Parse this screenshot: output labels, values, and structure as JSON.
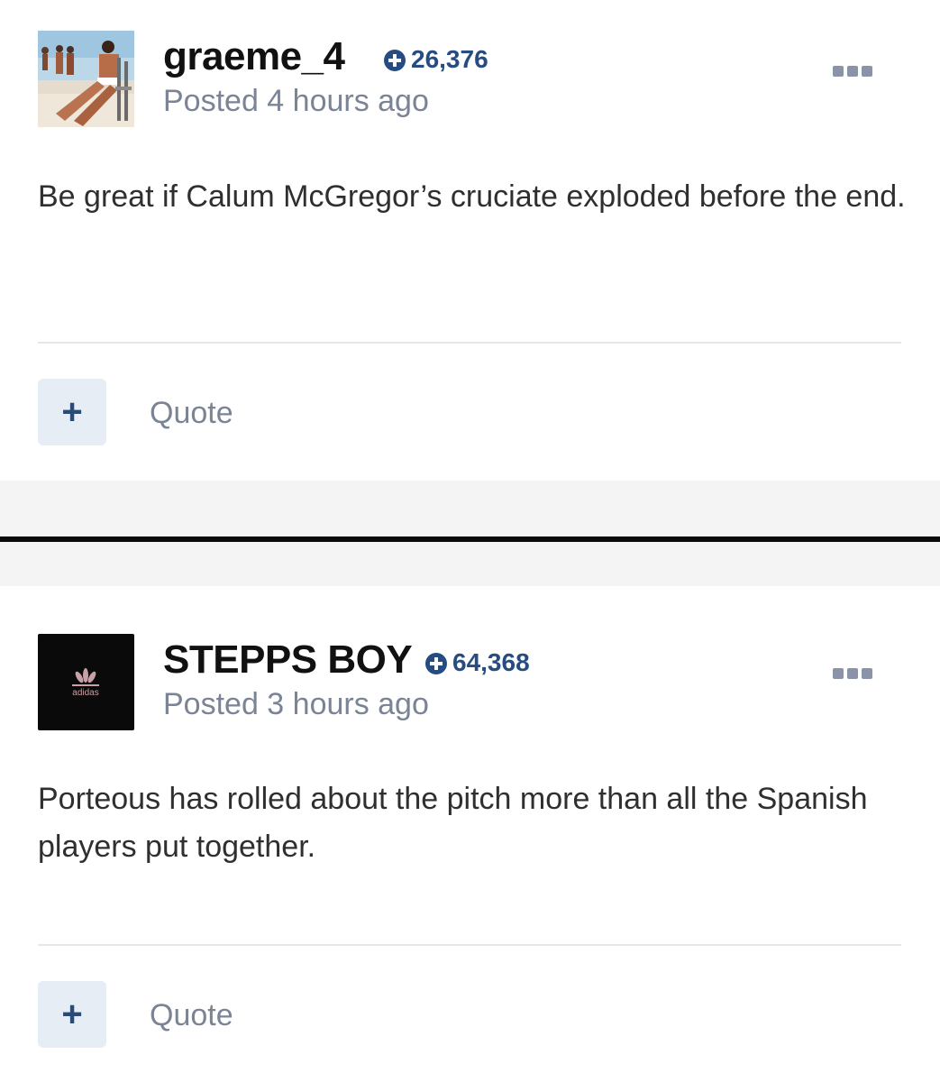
{
  "posts": [
    {
      "username": "graeme_4",
      "reputation": "26,376",
      "posted": "Posted 4 hours ago",
      "content": "Be great if Calum McGregor’s cruciate exploded before the end.",
      "rep_button": "+",
      "quote_label": "Quote"
    },
    {
      "username": "STEPPS BOY",
      "reputation": "64,368",
      "posted": "Posted 3 hours ago",
      "content": "Porteous has rolled about the pitch more than all the Spanish players put together.",
      "rep_button": "+",
      "quote_label": "Quote"
    }
  ],
  "icons": {
    "reputation": "plus-circle-icon",
    "more": "more-options-icon"
  },
  "colors": {
    "reputation": "#274c81",
    "meta_text": "#7b8494",
    "rep_button_bg": "#e6edf5"
  }
}
